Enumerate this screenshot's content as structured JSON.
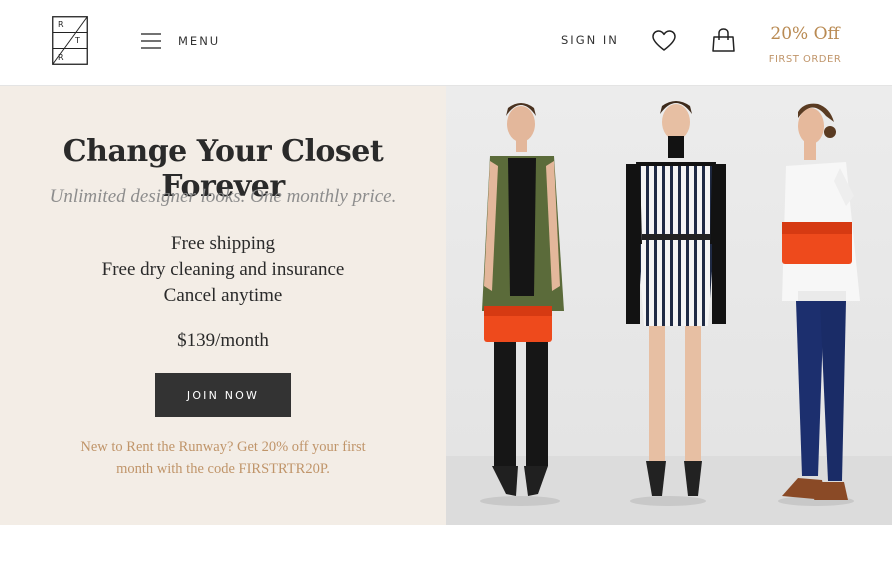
{
  "header": {
    "logo_letters": [
      "R",
      "T",
      "R"
    ],
    "menu_label": "MENU",
    "sign_in_label": "SIGN IN",
    "promo_title": "20% Off",
    "promo_subtitle": "FIRST ORDER",
    "icons": [
      "menu-icon",
      "heart-icon",
      "shopping-bag-icon"
    ]
  },
  "hero": {
    "headline": "Change Your Closet Forever",
    "subheadline": "Unlimited designer looks. One monthly price.",
    "benefits": [
      "Free shipping",
      "Free dry cleaning and insurance",
      "Cancel anytime"
    ],
    "price": "$139/month",
    "cta_label": "JOIN NOW",
    "promo_note": "New to Rent the Runway? Get 20% off your first month with the code FIRSTRTR20P."
  },
  "colors": {
    "accent_gold": "#b98a52",
    "hero_panel": "#f3ede6",
    "cta_background": "#333333",
    "clutch_orange": "#ee4a1c"
  }
}
